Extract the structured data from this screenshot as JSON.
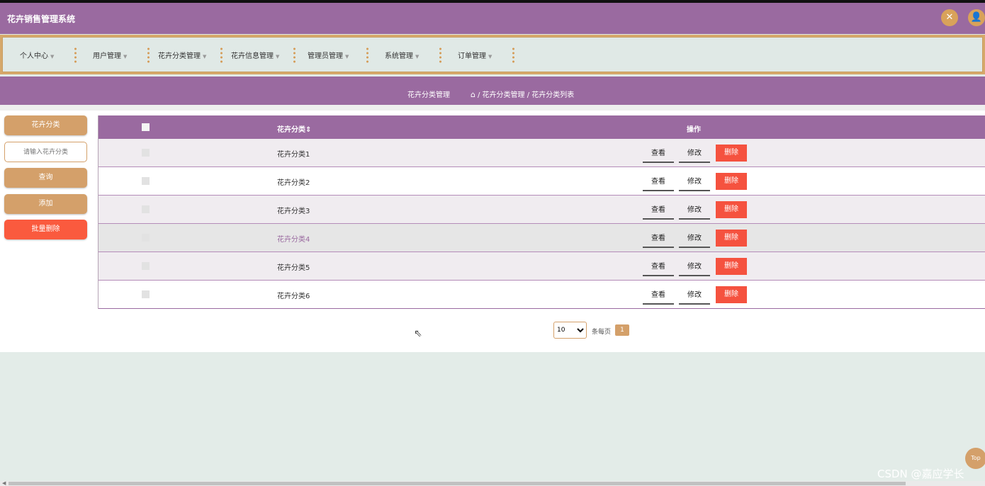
{
  "app": {
    "title": "花卉销售管理系统"
  },
  "header": {
    "fullscreen_icon": "expand-icon",
    "user_icon": "user-icon"
  },
  "nav": {
    "items": [
      {
        "label": "个人中心"
      },
      {
        "label": "用户管理"
      },
      {
        "label": "花卉分类管理"
      },
      {
        "label": "花卉信息管理"
      },
      {
        "label": "管理员管理"
      },
      {
        "label": "系统管理"
      },
      {
        "label": "订单管理"
      }
    ]
  },
  "breadcrumb": {
    "title": "花卉分类管理",
    "path": "/ 花卉分类管理 / 花卉分类列表"
  },
  "sidebar": {
    "label_button": "花卉分类",
    "search_placeholder": "请输入花卉分类",
    "query_button": "查询",
    "add_button": "添加",
    "batch_delete_button": "批量删除"
  },
  "table": {
    "headers": {
      "name": "花卉分类",
      "sort_icon": "sort-icon",
      "ops": "操作"
    },
    "actions": {
      "view": "查看",
      "edit": "修改",
      "delete": "删除"
    },
    "rows": [
      {
        "name": "花卉分类1"
      },
      {
        "name": "花卉分类2"
      },
      {
        "name": "花卉分类3"
      },
      {
        "name": "花卉分类4"
      },
      {
        "name": "花卉分类5"
      },
      {
        "name": "花卉分类6"
      }
    ]
  },
  "pagination": {
    "page_size": "10",
    "page_size_label": "条每页",
    "current_page": "1"
  },
  "back_to_top": "Top",
  "watermark": "CSDN @嘉应学长",
  "colors": {
    "primary": "#9a6aa0",
    "accent": "#d4a06a",
    "danger": "#f5523f"
  }
}
